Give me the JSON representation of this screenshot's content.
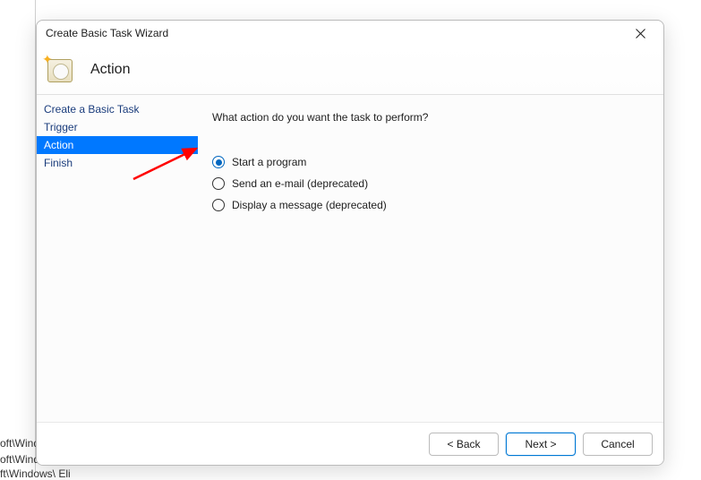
{
  "background": {
    "path1": "oft\\Wind…",
    "path2": "oft\\Windows\\U…",
    "path3": "ft\\Windows\\ Eli"
  },
  "dialog": {
    "title": "Create Basic Task Wizard",
    "header_title": "Action"
  },
  "sidebar": {
    "items": [
      {
        "label": "Create a Basic Task",
        "selected": false
      },
      {
        "label": "Trigger",
        "selected": false
      },
      {
        "label": "Action",
        "selected": true
      },
      {
        "label": "Finish",
        "selected": false
      }
    ]
  },
  "content": {
    "prompt": "What action do you want the task to perform?",
    "options": [
      {
        "label": "Start a program",
        "checked": true
      },
      {
        "label": "Send an e-mail (deprecated)",
        "checked": false
      },
      {
        "label": "Display a message (deprecated)",
        "checked": false
      }
    ]
  },
  "footer": {
    "back": "< Back",
    "next": "Next >",
    "cancel": "Cancel"
  },
  "annotation": {
    "arrow_color": "#ff0000"
  }
}
